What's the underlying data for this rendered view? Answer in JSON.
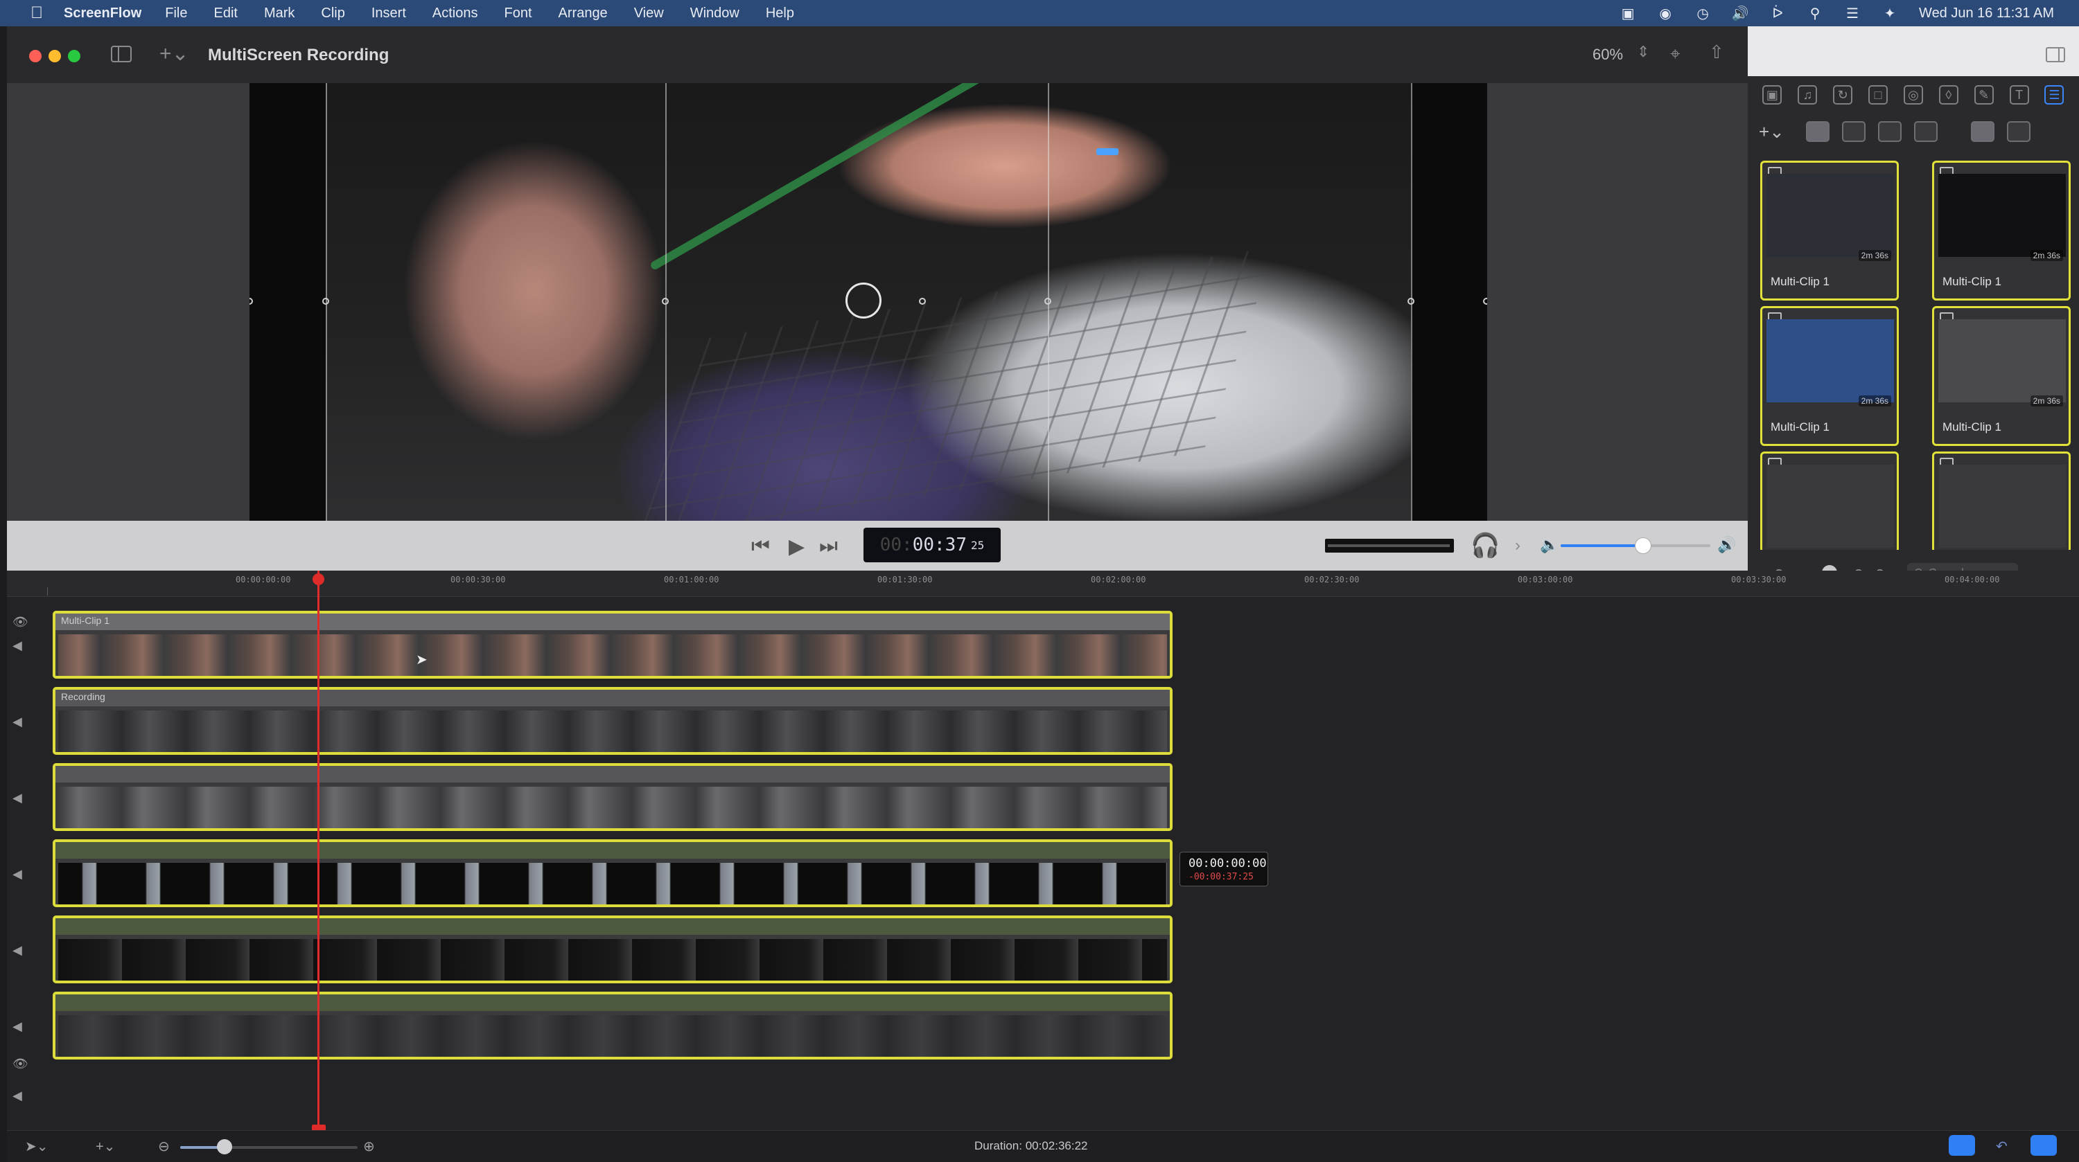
{
  "menubar": {
    "app_name": "ScreenFlow",
    "items": [
      "File",
      "Edit",
      "Mark",
      "Clip",
      "Insert",
      "Actions",
      "Font",
      "Arrange",
      "View",
      "Window",
      "Help"
    ],
    "clock": "Wed Jun 16  11:31 AM",
    "status_icons": [
      "screen-record-icon",
      "screenflow-helper-icon",
      "time-machine-icon",
      "volume-icon",
      "bluetooth-icon",
      "spotlight-icon",
      "control-center-icon",
      "siri-icon"
    ]
  },
  "window": {
    "title": "MultiScreen Recording",
    "zoom": "60%"
  },
  "transport": {
    "timecode_dim": "00:",
    "timecode_main": "00:37",
    "timecode_frames": "25",
    "volume_level": 0.55
  },
  "library": {
    "search_placeholder": "Search",
    "thumbnails": [
      {
        "name": "Multi-Clip 1",
        "duration": "2m 36s",
        "tone": "#2d2f36"
      },
      {
        "name": "Multi-Clip 1",
        "duration": "2m 36s",
        "tone": "#111113"
      },
      {
        "name": "Multi-Clip 1",
        "duration": "2m 36s",
        "tone": "#2f4f8a"
      },
      {
        "name": "Multi-Clip 1",
        "duration": "2m 36s",
        "tone": "#4a4a4e"
      },
      {
        "name": "",
        "duration": "",
        "tone": "#3a3a3c"
      },
      {
        "name": "",
        "duration": "",
        "tone": "#3a3a3c"
      }
    ]
  },
  "timeline": {
    "ruler_labels": [
      "00:00:00:00",
      "00:00:30:00",
      "00:01:00:00",
      "00:01:30:00",
      "00:02:00:00",
      "00:02:30:00",
      "00:03:00:00",
      "00:03:30:00",
      "00:04:00:00"
    ],
    "clips": [
      {
        "label": "Multi-Clip 1"
      },
      {
        "label": "Recording"
      },
      {
        "label": ""
      },
      {
        "label": ""
      },
      {
        "label": ""
      },
      {
        "label": ""
      }
    ],
    "tooltip": {
      "time": "00:00:00:00",
      "delta": "-00:00:37:25"
    }
  },
  "bottombar": {
    "duration": "Duration: 00:02:36:22",
    "timeline_zoom": 0.25
  },
  "colors": {
    "clip_border": "#dcdd3b",
    "playhead": "#e02b2b",
    "accent_blue": "#2f7ff5",
    "menubar": "#2c4a78"
  }
}
